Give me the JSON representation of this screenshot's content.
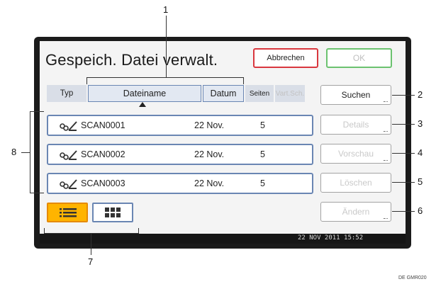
{
  "screen": {
    "title": "Gespeich. Datei verwalt.",
    "cancel_label": "Abbrechen",
    "ok_label": "OK"
  },
  "table": {
    "headers": {
      "typ": "Typ",
      "dateiname": "Dateiname",
      "datum": "Datum",
      "seiten": "Seiten",
      "vartsch": "Vart.Sch."
    },
    "sort_indicator_icon": "sort-ascending-arrow-icon",
    "rows": [
      {
        "type_icon": "scan-document-icon",
        "name": "SCAN0001",
        "date": "22 Nov.",
        "pages": "5"
      },
      {
        "type_icon": "scan-document-icon",
        "name": "SCAN0002",
        "date": "22 Nov.",
        "pages": "5"
      },
      {
        "type_icon": "scan-document-icon",
        "name": "SCAN0003",
        "date": "22 Nov.",
        "pages": "5"
      }
    ]
  },
  "side_buttons": {
    "suchen": "Suchen",
    "details": "Details",
    "vorschau": "Vorschau",
    "loeschen": "Löschen",
    "aendern": "Ändern"
  },
  "view_toggle": {
    "list_icon": "list-view-icon",
    "grid_icon": "thumbnail-view-icon",
    "active": "list"
  },
  "status": {
    "datetime": "22 NOV  2011 15:52"
  },
  "callouts": {
    "c1": "1",
    "c2": "2",
    "c3": "3",
    "c4": "4",
    "c5": "5",
    "c6": "6",
    "c7": "7",
    "c8": "8"
  },
  "image_code": "DE GMR020",
  "colors": {
    "accent_blue": "#6a86b3",
    "cancel_border": "#d9373e",
    "ok_border": "#6bc26f",
    "active_view": "#ffb400"
  }
}
